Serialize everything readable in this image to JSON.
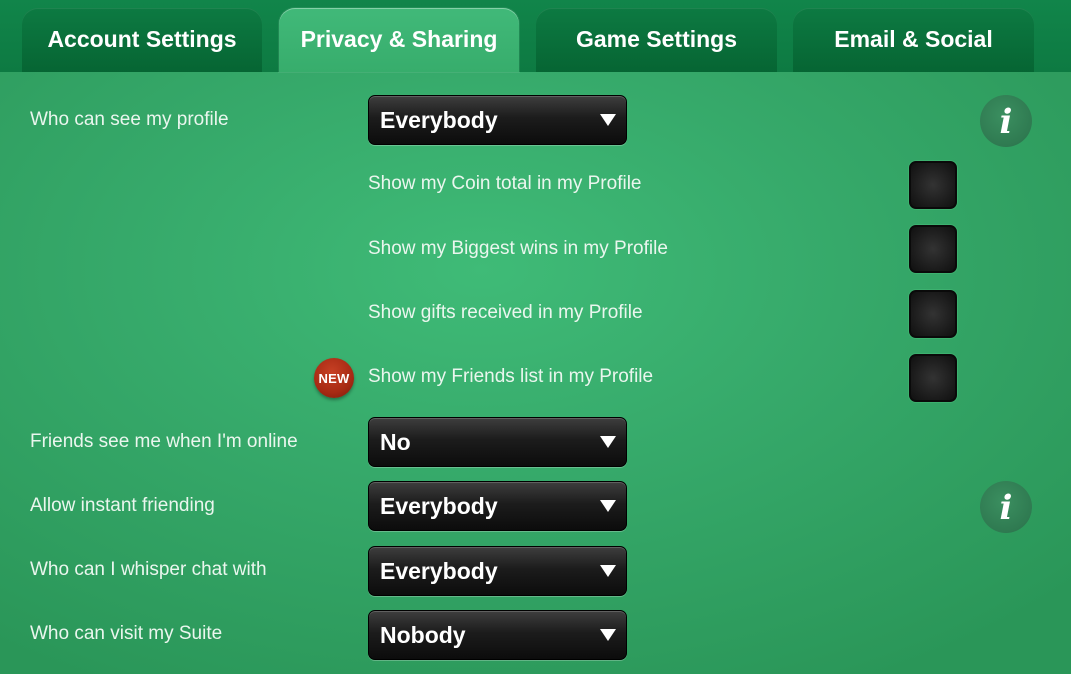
{
  "tabs": [
    {
      "label": "Account Settings",
      "active": false
    },
    {
      "label": "Privacy & Sharing",
      "active": true
    },
    {
      "label": "Game Settings",
      "active": false
    },
    {
      "label": "Email & Social",
      "active": false
    }
  ],
  "profile": {
    "label": "Who can see my profile",
    "value": "Everybody",
    "options": [
      {
        "label": "Show my Coin total in my Profile",
        "checked": false,
        "badge": ""
      },
      {
        "label": "Show my Biggest wins in my Profile",
        "checked": false,
        "badge": ""
      },
      {
        "label": "Show gifts received in my Profile",
        "checked": false,
        "badge": ""
      },
      {
        "label": "Show my Friends list in my Profile",
        "checked": false,
        "badge": "NEW"
      }
    ]
  },
  "settings": [
    {
      "label": "Friends see me when I'm online",
      "value": "No"
    },
    {
      "label": "Allow instant friending",
      "value": "Everybody"
    },
    {
      "label": "Who can I whisper chat with",
      "value": "Everybody"
    },
    {
      "label": "Who can visit my Suite",
      "value": "Nobody"
    }
  ],
  "info_icon": {
    "glyph": "i",
    "icon": "info-icon"
  },
  "colors": {
    "background": "#36a96a",
    "tab_inactive": "#0d7a42",
    "tab_active": "#3db574",
    "dropdown": "#1a1a1a",
    "badge": "#a72a14"
  }
}
